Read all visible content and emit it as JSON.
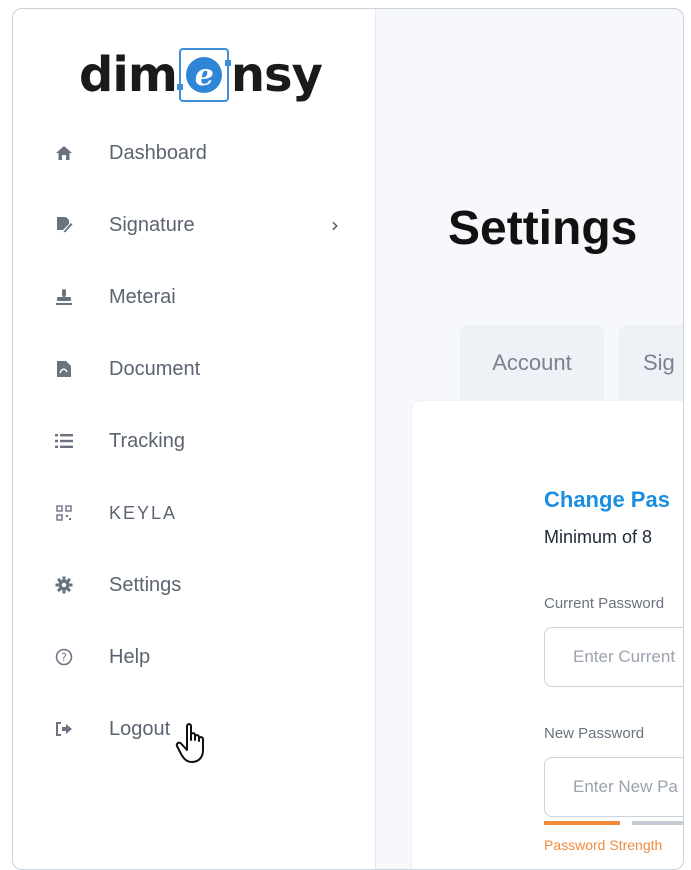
{
  "brand": {
    "logo_prefix": "dim",
    "logo_mark": "e",
    "logo_suffix": "nsy"
  },
  "sidebar": {
    "items": [
      {
        "label": "Dashboard",
        "icon": "home-icon"
      },
      {
        "label": "Signature",
        "icon": "signature-icon",
        "has_submenu": true
      },
      {
        "label": "Meterai",
        "icon": "stamp-icon"
      },
      {
        "label": "Document",
        "icon": "pdf-document-icon"
      },
      {
        "label": "Tracking",
        "icon": "list-icon"
      },
      {
        "label": "KEYLA",
        "icon": "qr-code-icon"
      },
      {
        "label": "Settings",
        "icon": "gear-icon"
      },
      {
        "label": "Help",
        "icon": "help-circle-icon"
      },
      {
        "label": "Logout",
        "icon": "logout-icon"
      }
    ]
  },
  "main": {
    "title": "Settings",
    "tabs": [
      {
        "label": "Account"
      },
      {
        "label": "Sig"
      }
    ],
    "card": {
      "title": "Change Pas",
      "subtitle": "Minimum of 8",
      "current_password": {
        "label": "Current Password",
        "placeholder": "Enter Current"
      },
      "new_password": {
        "label": "New Password",
        "placeholder": "Enter New Pa"
      },
      "strength_text": "Password Strength"
    }
  },
  "colors": {
    "accent": "#1a8ee0",
    "strength_weak": "#f28a3c"
  }
}
